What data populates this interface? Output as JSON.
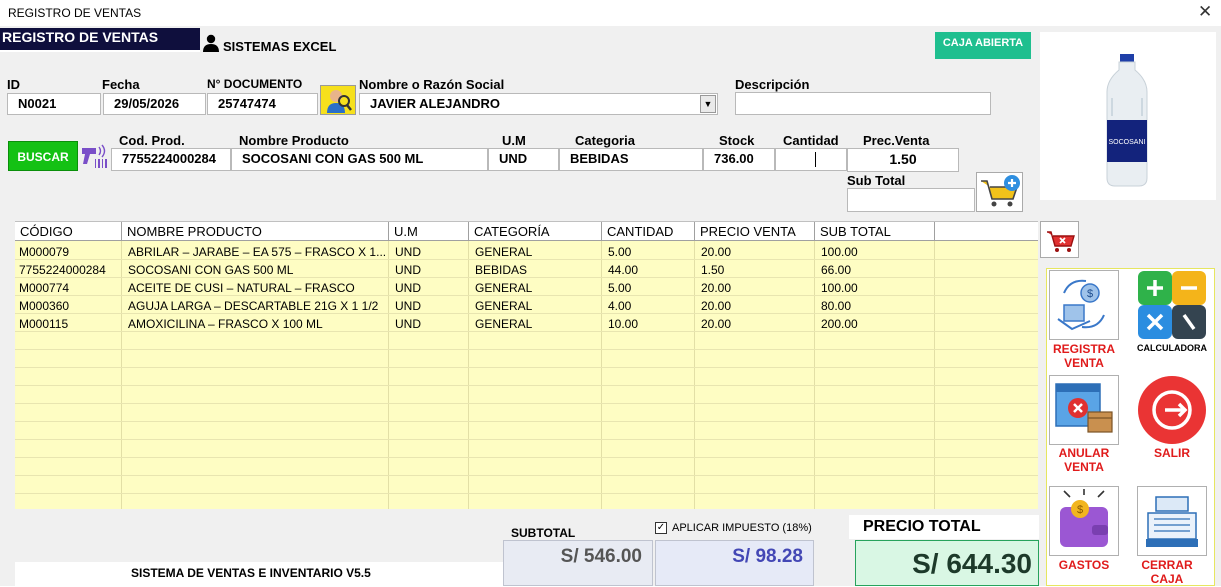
{
  "window": {
    "title": "REGISTRO DE VENTAS",
    "close": "✕"
  },
  "header": {
    "banner": "REGISTRO DE VENTAS",
    "brand": "SISTEMAS EXCEL",
    "status_button": "CAJA ABIERTA"
  },
  "form": {
    "id_label": "ID",
    "id_value": "N0021",
    "fecha_label": "Fecha",
    "fecha_value": "29/05/2026",
    "doc_label": "N° DOCUMENTO",
    "doc_value": "25747474",
    "cliente_label": "Nombre o Razón Social",
    "cliente_value": "JAVIER ALEJANDRO",
    "desc_label": "Descripción",
    "desc_value": ""
  },
  "product": {
    "search_button": "BUSCAR",
    "cod_label": "Cod. Prod.",
    "cod_value": "7755224000284",
    "nombre_label": "Nombre Producto",
    "nombre_value": "SOCOSANI CON GAS 500 ML",
    "um_label": "U.M",
    "um_value": "UND",
    "cat_label": "Categoria",
    "cat_value": "BEBIDAS",
    "stock_label": "Stock",
    "stock_value": "736.00",
    "cant_label": "Cantidad",
    "cant_value": "",
    "prec_label": "Prec.Venta",
    "prec_value": "1.50",
    "subtotal_label": "Sub Total",
    "subtotal_value": ""
  },
  "table": {
    "headers": [
      "CÓDIGO",
      "NOMBRE PRODUCTO",
      "U.M",
      "CATEGORÍA",
      "CANTIDAD",
      "PRECIO VENTA",
      "SUB TOTAL"
    ],
    "rows": [
      [
        "M000079",
        "ABRILAR – JARABE – EA 575 – FRASCO X 1...",
        "UND",
        "GENERAL",
        "5.00",
        "20.00",
        "100.00"
      ],
      [
        "7755224000284",
        "SOCOSANI CON GAS 500 ML",
        "UND",
        "BEBIDAS",
        "44.00",
        "1.50",
        "66.00"
      ],
      [
        "M000774",
        "ACEITE DE CUSI – NATURAL – FRASCO",
        "UND",
        "GENERAL",
        "5.00",
        "20.00",
        "100.00"
      ],
      [
        "M000360",
        "AGUJA LARGA – DESCARTABLE 21G X 1 1/2",
        "UND",
        "GENERAL",
        "4.00",
        "20.00",
        "80.00"
      ],
      [
        "M000115",
        "AMOXICILINA – FRASCO X 100 ML",
        "UND",
        "GENERAL",
        "10.00",
        "20.00",
        "200.00"
      ]
    ]
  },
  "actions": {
    "registra": "REGISTRA VENTA",
    "calculadora": "CALCULADORA",
    "anular": "ANULAR VENTA",
    "salir": "SALIR",
    "gastos": "GASTOS",
    "cerrar": "CERRAR CAJA"
  },
  "totals": {
    "subtotal_label": "SUBTOTAL",
    "subtotal_value": "S/ 546.00",
    "tax_label": "APLICAR IMPUESTO (18%)",
    "tax_checked": true,
    "tax_value": "S/ 98.28",
    "total_label": "PRECIO TOTAL",
    "total_value": "S/ 644.30"
  },
  "footer": {
    "version": "SISTEMA DE VENTAS E INVENTARIO V5.5"
  },
  "icons": {
    "user": "user-icon",
    "client_search": "client-search-icon",
    "barcode": "barcode-scanner-icon",
    "add_cart": "add-to-cart-icon",
    "remove_cart": "remove-from-cart-icon",
    "product_image": "water-bottle-image"
  },
  "colors": {
    "banner": "#0f0f3d",
    "caja": "#1fbf8f",
    "buscar": "#14c114",
    "grid": "#fefdc3",
    "danger": "#e01b1b",
    "total_bg": "#d9f7e4"
  }
}
